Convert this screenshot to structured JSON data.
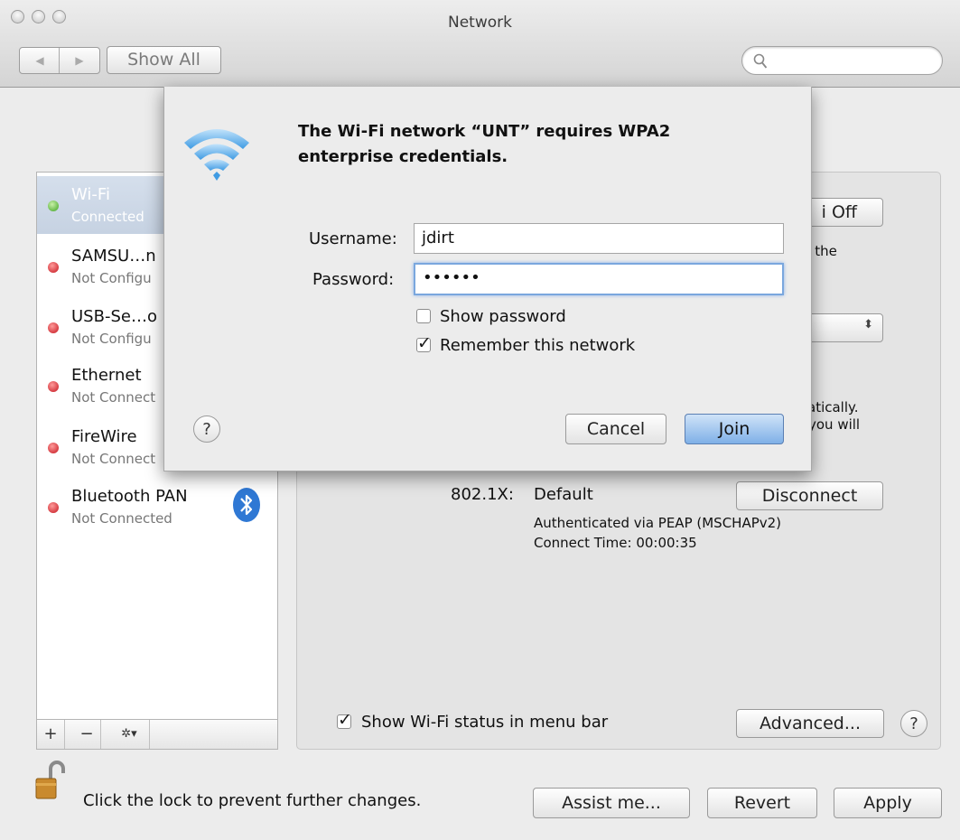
{
  "window": {
    "title": "Network"
  },
  "toolbar": {
    "back_label": "◀",
    "forward_label": "▶",
    "show_all_label": "Show All",
    "search_placeholder": ""
  },
  "sidebar": {
    "items": [
      {
        "name": "Wi-Fi",
        "status": "Connected",
        "dot_color": "#5fbf3a"
      },
      {
        "name": "SAMSU…n",
        "status": "Not Configu",
        "dot_color": "#d8202a"
      },
      {
        "name": "USB-Se…o",
        "status": "Not Configu",
        "dot_color": "#d8202a"
      },
      {
        "name": "Ethernet",
        "status": "Not Connect",
        "dot_color": "#d8202a"
      },
      {
        "name": "FireWire",
        "status": "Not Connect",
        "dot_color": "#d8202a"
      },
      {
        "name": "Bluetooth PAN",
        "status": "Not Connected",
        "dot_color": "#d8202a"
      }
    ],
    "add_label": "+",
    "remove_label": "−",
    "actions_label": "✲▾"
  },
  "content": {
    "turn_off_label": "i Off",
    "has_the": "has the",
    "atically": "atically.",
    "you_will": "you will",
    "dot1x_label": "802.1X:",
    "dot1x_value": "Default",
    "disconnect_label": "Disconnect",
    "auth_line": "Authenticated via PEAP (MSCHAPv2)",
    "connect_time": "Connect Time: 00:00:35",
    "show_status_label": "Show Wi-Fi status in menu bar",
    "advanced_label": "Advanced...",
    "help_label": "?"
  },
  "footer": {
    "lock_text": "Click the lock to prevent further changes.",
    "assist_label": "Assist me...",
    "revert_label": "Revert",
    "apply_label": "Apply"
  },
  "dialog": {
    "message": "The Wi-Fi network “UNT” requires WPA2 enterprise credentials.",
    "message_line1": "The Wi-Fi network “UNT” requires WPA2",
    "message_line2": "enterprise credentials.",
    "username_label": "Username:",
    "username_value": "jdirt",
    "password_label": "Password:",
    "password_value": "••••••",
    "show_password_label": "Show password",
    "show_password_checked": false,
    "remember_label": "Remember this network",
    "remember_checked": true,
    "help_label": "?",
    "cancel_label": "Cancel",
    "join_label": "Join"
  }
}
